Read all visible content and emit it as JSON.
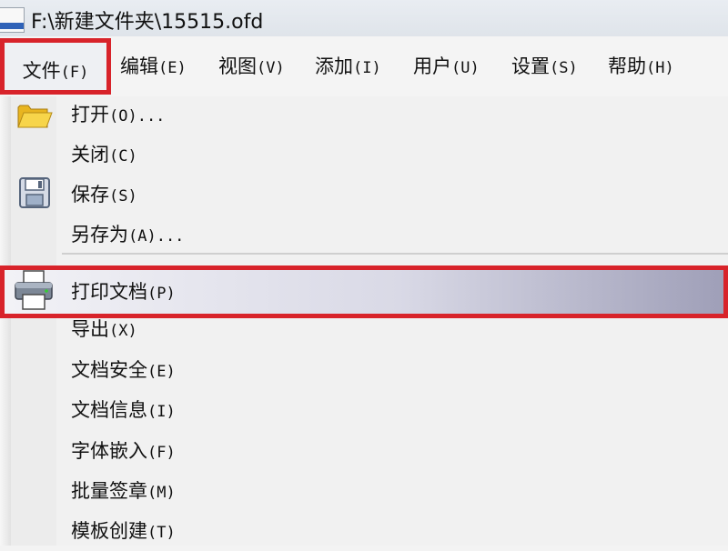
{
  "window": {
    "title": "F:\\新建文件夹\\15515.ofd",
    "icon": "app-icon"
  },
  "menubar": {
    "items": [
      {
        "label": "文件",
        "accel": "(F)"
      },
      {
        "label": "编辑",
        "accel": "(E)"
      },
      {
        "label": "视图",
        "accel": "(V)"
      },
      {
        "label": "添加",
        "accel": "(I)"
      },
      {
        "label": "用户",
        "accel": "(U)"
      },
      {
        "label": "设置",
        "accel": "(S)"
      },
      {
        "label": "帮助",
        "accel": "(H)"
      }
    ]
  },
  "file_menu": {
    "items": [
      {
        "label": "打开",
        "accel": "(O)...",
        "icon": "folder-open-icon"
      },
      {
        "label": "关闭",
        "accel": "(C)"
      },
      {
        "label": "保存",
        "accel": "(S)",
        "icon": "save-icon"
      },
      {
        "label": "另存为",
        "accel": "(A)..."
      },
      {
        "label": "打印文档",
        "accel": "(P)",
        "icon": "printer-icon",
        "highlighted": true
      },
      {
        "label": "导出",
        "accel": "(X)"
      },
      {
        "label": "文档安全",
        "accel": "(E)"
      },
      {
        "label": "文档信息",
        "accel": "(I)"
      },
      {
        "label": "字体嵌入",
        "accel": "(F)"
      },
      {
        "label": "批量签章",
        "accel": "(M)"
      },
      {
        "label": "模板创建",
        "accel": "(T)"
      }
    ]
  },
  "colors": {
    "highlight_border": "#d8232a",
    "selection_gradient_end": "#9f9fb8"
  }
}
